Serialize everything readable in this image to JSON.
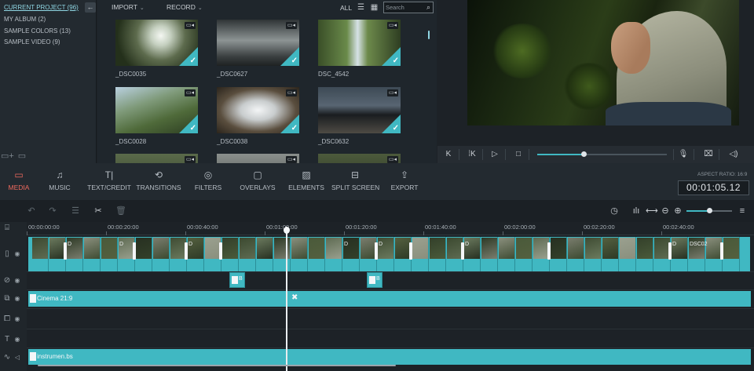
{
  "library": {
    "albums": [
      {
        "label": "CURRENT PROJECT (96)",
        "active": true
      },
      {
        "label": "MY ALBUM (2)",
        "active": false
      },
      {
        "label": "SAMPLE COLORS (13)",
        "active": false
      },
      {
        "label": "SAMPLE VIDEO (9)",
        "active": false
      }
    ],
    "collapse_glyph": "←",
    "bottom_icons": [
      "add-folder-icon",
      "delete-folder-icon"
    ]
  },
  "media_toolbar": {
    "import_label": "IMPORT",
    "record_label": "RECORD",
    "filter_label": "ALL",
    "search_placeholder": "Search"
  },
  "media": [
    {
      "label": "_DSC0035",
      "type": "video",
      "selected": true
    },
    {
      "label": "_DSC0627",
      "type": "video",
      "selected": true
    },
    {
      "label": "DSC_4542",
      "type": "video",
      "selected": true
    },
    {
      "label": "_DSC0028",
      "type": "video",
      "selected": true
    },
    {
      "label": "_DSC0038",
      "type": "video",
      "selected": true
    },
    {
      "label": "_DSC0632",
      "type": "video",
      "selected": true
    }
  ],
  "playback": {
    "progress": 0.36,
    "buttons": [
      "skip-back-icon",
      "step-back-icon",
      "play-icon",
      "stop-icon",
      "microphone-icon",
      "snapshot-icon",
      "volume-icon"
    ]
  },
  "main_toolbar": {
    "items": [
      {
        "label": "MEDIA",
        "icon": "folder-icon",
        "active": true
      },
      {
        "label": "MUSIC",
        "icon": "music-note-icon",
        "active": false
      },
      {
        "label": "TEXT/CREDIT",
        "icon": "text-icon",
        "active": false
      },
      {
        "label": "TRANSITIONS",
        "icon": "transition-icon",
        "active": false
      },
      {
        "label": "FILTERS",
        "icon": "filter-icon",
        "active": false
      },
      {
        "label": "OVERLAYS",
        "icon": "overlay-icon",
        "active": false
      },
      {
        "label": "ELEMENTS",
        "icon": "elements-icon",
        "active": false
      },
      {
        "label": "SPLIT SCREEN",
        "icon": "split-screen-icon",
        "active": false
      },
      {
        "label": "EXPORT",
        "icon": "export-icon",
        "active": false
      }
    ],
    "aspect_ratio": "ASPECT RATIO: 16:9",
    "timecode": "00:01:05.12"
  },
  "timeline_toolbar": {
    "icons": [
      "undo-icon",
      "redo-icon",
      "adjust-icon",
      "cut-icon",
      "delete-icon",
      "speed-icon",
      "audio-mixer-icon",
      "fit-icon",
      "zoom-out-icon",
      "zoom-in-icon",
      "menu-icon"
    ],
    "zoom": 0.5
  },
  "timeline": {
    "ruler": [
      "00:00:00:00",
      "00:00:20:00",
      "00:00:40:00",
      "00:01:00:00",
      "00:01:20:00",
      "00:01:40:00",
      "00:02:00:00",
      "00:02:20:00",
      "00:02:40:00"
    ],
    "clip_labels": [
      "D",
      "D",
      "D",
      "D",
      "D",
      "D",
      "D",
      "DSC02"
    ],
    "effect_markers": [
      {
        "label": "B"
      },
      {
        "label": "B"
      }
    ],
    "text_track": {
      "name": "Cinema 21:9"
    },
    "audio_track": {
      "name": "instrumen.bs"
    },
    "playhead_time": "00:01:05.12",
    "track_icons": [
      "timeline-settings-icon",
      "video-track-icon",
      "effects-track-icon",
      "overlay-track-icon",
      "pip-track-icon",
      "text-track-icon",
      "audio-track-icon"
    ]
  },
  "colors": {
    "accent": "#40b8c2",
    "active_tab": "#ef6a5e",
    "background": "#1d2227"
  }
}
